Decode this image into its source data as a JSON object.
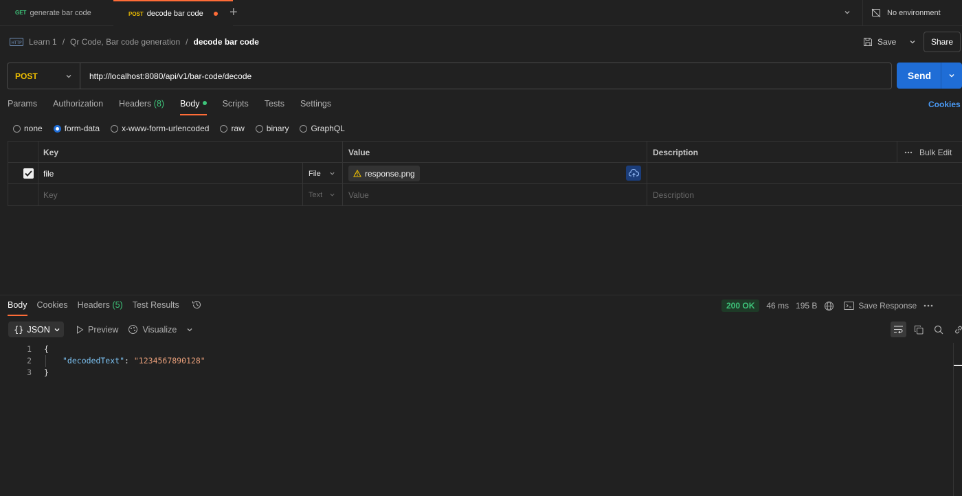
{
  "tabs": [
    {
      "method": "GET",
      "title": "generate bar code",
      "active": false
    },
    {
      "method": "POST",
      "title": "decode bar code",
      "active": true
    }
  ],
  "environment": {
    "label": "No environment"
  },
  "breadcrumb": {
    "items": [
      "Learn 1",
      "Qr Code, Bar code generation"
    ],
    "current": "decode bar code",
    "separator": "/"
  },
  "actions": {
    "save": "Save",
    "share": "Share"
  },
  "request": {
    "method": "POST",
    "url": "http://localhost:8080/api/v1/bar-code/decode",
    "send": "Send"
  },
  "request_tabs": [
    {
      "label": "Params"
    },
    {
      "label": "Authorization"
    },
    {
      "label": "Headers",
      "count": "(8)"
    },
    {
      "label": "Body",
      "active": true
    },
    {
      "label": "Scripts"
    },
    {
      "label": "Tests"
    },
    {
      "label": "Settings"
    }
  ],
  "cookies_link": "Cookies",
  "body_types": [
    "none",
    "form-data",
    "x-www-form-urlencoded",
    "raw",
    "binary",
    "GraphQL"
  ],
  "body_type_selected": "form-data",
  "form_table": {
    "headers": {
      "key": "Key",
      "value": "Value",
      "description": "Description",
      "bulk_edit": "Bulk Edit"
    },
    "rows": [
      {
        "checked": true,
        "key": "file",
        "type": "File",
        "value": "response.png",
        "description": ""
      }
    ],
    "empty_row": {
      "key": "Key",
      "type": "Text",
      "value": "Value",
      "description": "Description"
    }
  },
  "response": {
    "tabs": [
      {
        "label": "Body",
        "active": true
      },
      {
        "label": "Cookies"
      },
      {
        "label": "Headers",
        "count": "(5)"
      },
      {
        "label": "Test Results"
      }
    ],
    "status": "200 OK",
    "time": "46 ms",
    "size": "195 B",
    "save_response": "Save Response",
    "format": "JSON",
    "preview": "Preview",
    "visualize": "Visualize",
    "lines": [
      {
        "n": "1",
        "text": "{"
      },
      {
        "n": "2",
        "key": "\"decodedText\"",
        "colon": ": ",
        "value": "\"1234567890128\""
      },
      {
        "n": "3",
        "text": "}"
      }
    ]
  },
  "colors": {
    "accent": "#ff6c37",
    "send": "#1f6dd6",
    "method_post": "#f0c000",
    "method_get": "#3ec47a",
    "status_ok": "#3ec47a"
  }
}
